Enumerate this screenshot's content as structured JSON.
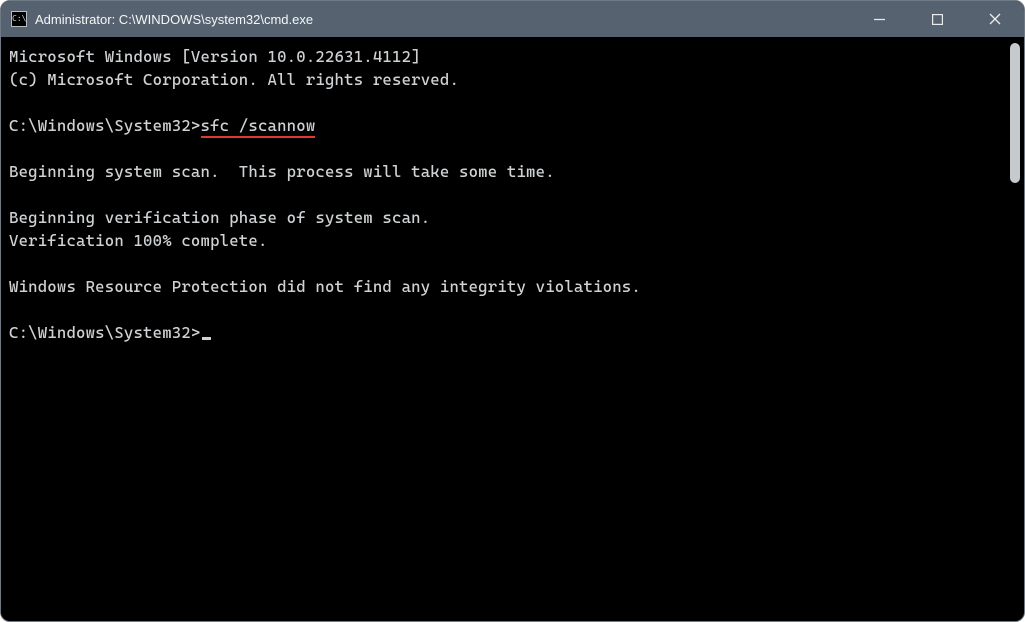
{
  "titlebar": {
    "icon_label": "C:\\",
    "title": "Administrator: C:\\WINDOWS\\system32\\cmd.exe"
  },
  "terminal": {
    "line_version": "Microsoft Windows [Version 10.0.22631.4112]",
    "line_copyright": "(c) Microsoft Corporation. All rights reserved.",
    "prompt1_path": "C:\\Windows\\System32>",
    "command1": "sfc /scannow",
    "line_begin_scan": "Beginning system scan.  This process will take some time.",
    "line_verify_phase": "Beginning verification phase of system scan.",
    "line_verify_complete": "Verification 100% complete.",
    "line_result": "Windows Resource Protection did not find any integrity violations.",
    "prompt2_path": "C:\\Windows\\System32>"
  }
}
